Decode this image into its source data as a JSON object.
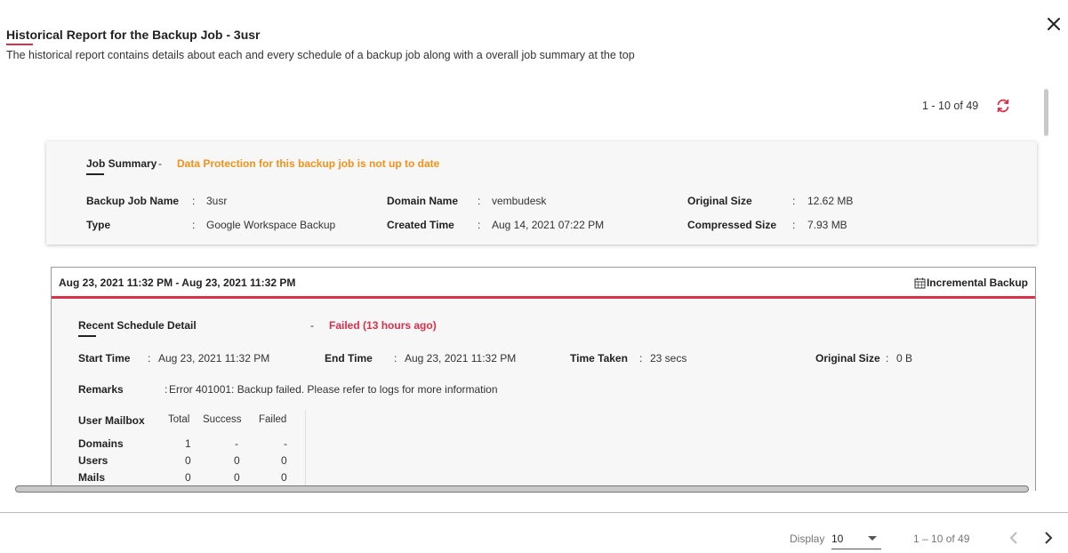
{
  "header": {
    "title": "Historical Report for the Backup Job - 3usr",
    "subtitle": "The historical report contains details about each and every schedule of a backup job along with a overall job summary at the top"
  },
  "pager_top": "1 - 10 of 49",
  "job_summary": {
    "label": "Job Summary",
    "dash": "-",
    "warning": "Data Protection for this backup job is not up to date",
    "fields": {
      "backup_job_name": {
        "label": "Backup Job Name",
        "value": "3usr"
      },
      "type": {
        "label": "Type",
        "value": "Google Workspace Backup"
      },
      "domain_name": {
        "label": "Domain Name",
        "value": "vembudesk"
      },
      "created_time": {
        "label": "Created Time",
        "value": "Aug 14, 2021 07:22 PM"
      },
      "original_size": {
        "label": "Original Size",
        "value": "12.62 MB"
      },
      "compressed_size": {
        "label": "Compressed Size",
        "value": "7.93 MB"
      }
    }
  },
  "schedule": {
    "range": "Aug 23, 2021 11:32 PM - Aug 23, 2021 11:32 PM",
    "backup_type": "Incremental Backup",
    "recent_label": "Recent Schedule Detail",
    "dash": "-",
    "status": "Failed",
    "status_ago": "(13 hours ago)",
    "start_time": {
      "label": "Start Time",
      "value": "Aug 23, 2021 11:32 PM"
    },
    "end_time": {
      "label": "End Time",
      "value": "Aug 23, 2021 11:32 PM"
    },
    "time_taken": {
      "label": "Time Taken",
      "value": "23 secs"
    },
    "original_size": {
      "label": "Original Size",
      "value": "0 B"
    },
    "remarks": {
      "label": "Remarks",
      "value": "Error 401001: Backup failed. Please refer to logs for more information"
    },
    "mailbox_table": {
      "title": "User Mailbox",
      "headers": [
        "Total",
        "Success",
        "Failed"
      ],
      "rows": [
        {
          "name": "Domains",
          "total": "1",
          "success": "-",
          "failed": "-"
        },
        {
          "name": "Users",
          "total": "0",
          "success": "0",
          "failed": "0"
        },
        {
          "name": "Mails",
          "total": "0",
          "success": "0",
          "failed": "0"
        }
      ]
    }
  },
  "footer": {
    "display_label": "Display",
    "display_value": "10",
    "pager": "1 – 10 of 49"
  },
  "colors": {
    "accent": "#d9304b",
    "warning": "#f0921c"
  }
}
